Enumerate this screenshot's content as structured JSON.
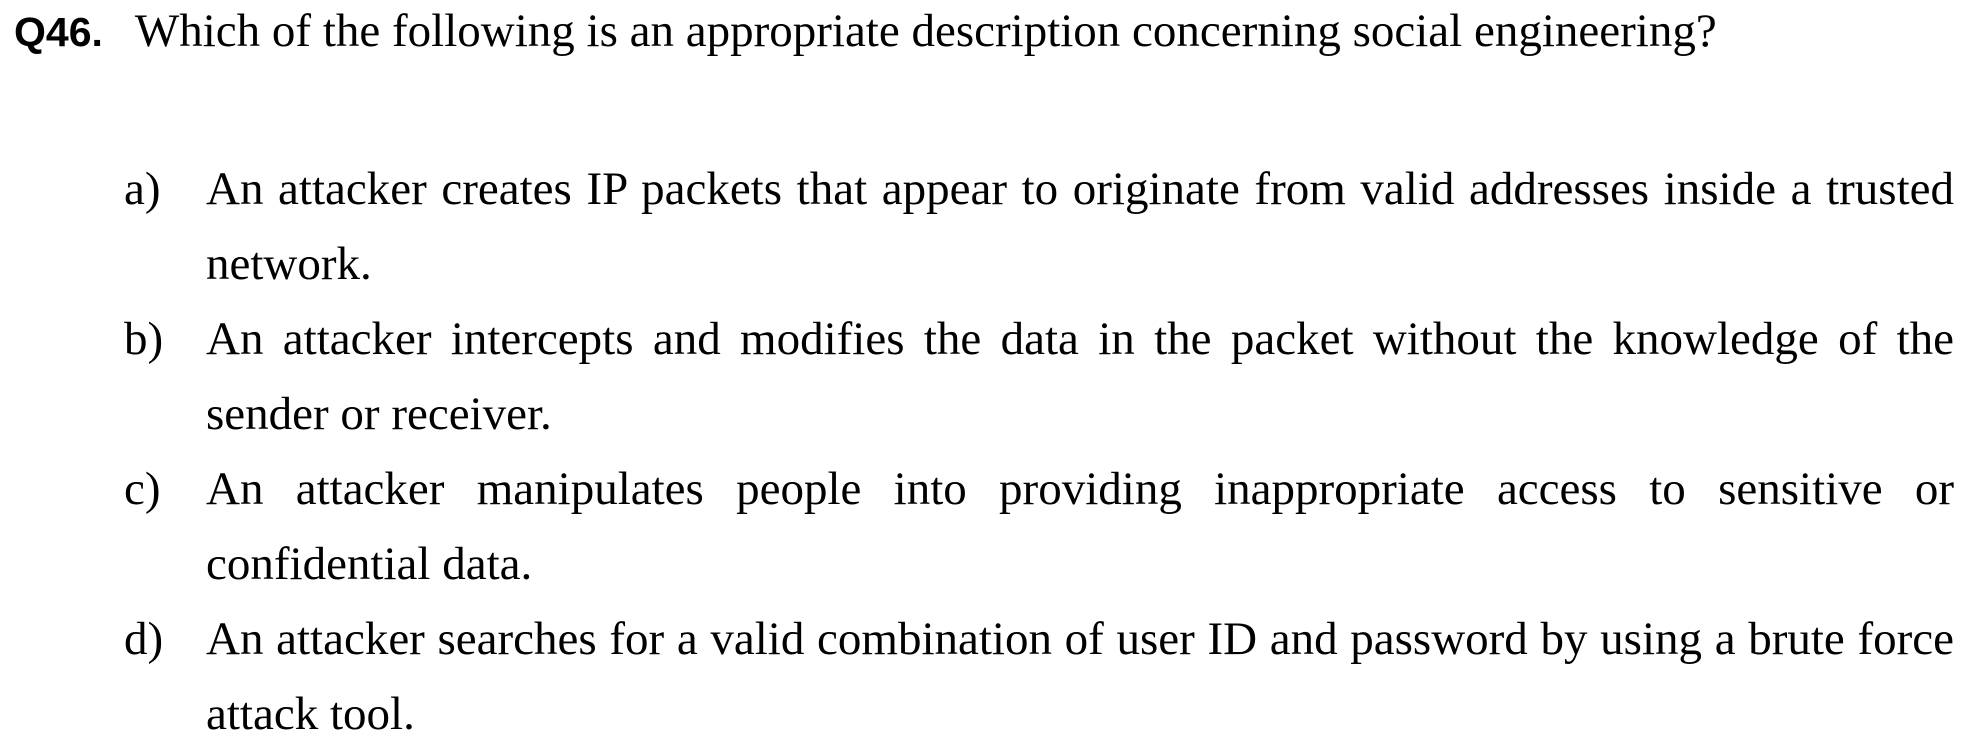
{
  "question": {
    "number": "Q46.",
    "text": "Which of the following is an appropriate description concerning social engineering?"
  },
  "options": [
    {
      "letter": "a)",
      "text": "An attacker creates IP packets that appear to originate from valid addresses inside a trusted network."
    },
    {
      "letter": "b)",
      "text": "An attacker intercepts and modifies the data in the packet without the knowledge of the sender or receiver."
    },
    {
      "letter": "c)",
      "text": "An attacker manipulates people into providing inappropriate access to sensitive or confidential data."
    },
    {
      "letter": "d)",
      "text": "An attacker searches for a valid combination of user ID and password by using a brute force attack tool."
    }
  ]
}
